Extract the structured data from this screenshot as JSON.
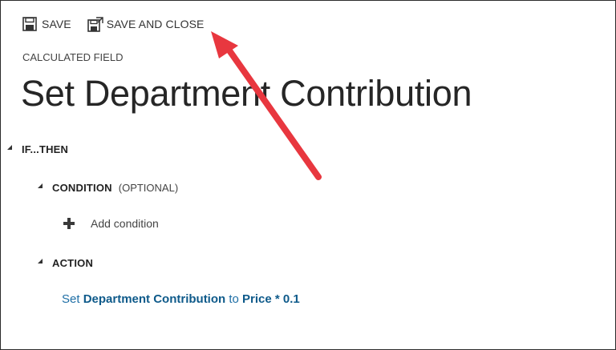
{
  "toolbar": {
    "save_label": "SAVE",
    "save_close_label": "SAVE AND CLOSE"
  },
  "header": {
    "entity_type": "CALCULATED FIELD",
    "title": "Set Department Contribution"
  },
  "sections": {
    "if_then_label": "IF...THEN",
    "condition_label": "CONDITION",
    "condition_optional": "(OPTIONAL)",
    "add_condition_label": "Add condition",
    "action_label": "ACTION"
  },
  "action_expression": {
    "prefix": "Set",
    "field": "Department Contribution",
    "connector": "to",
    "value": "Price * 0.1"
  },
  "colors": {
    "annotation_arrow": "#e8373f",
    "link_blue": "#1f6fa6",
    "link_blue_bold": "#0e5a8a"
  },
  "icons": {
    "save": "save-icon",
    "save_close": "save-close-icon",
    "add": "plus-icon",
    "expand": "collapse-triangle-icon"
  }
}
